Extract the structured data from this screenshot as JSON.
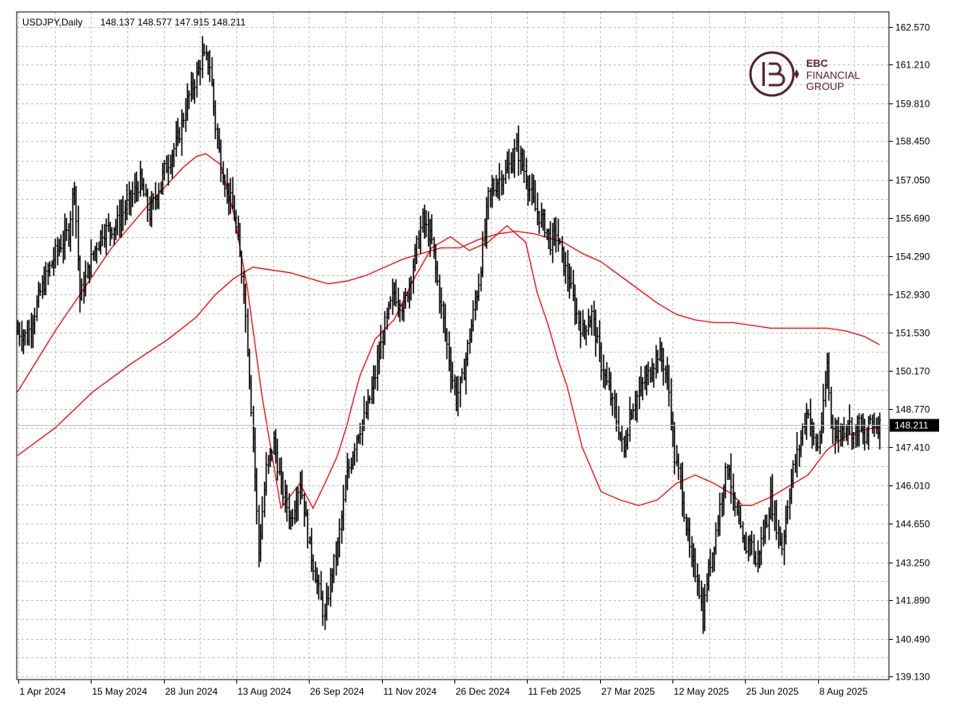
{
  "header": {
    "symbol": "USDJPY,Daily",
    "ohlc": "148.137 148.577 147.915 148.211"
  },
  "logo": {
    "line1": "EBC",
    "line2": "FINANCIAL",
    "line3": "GROUP",
    "color": "#5a2230"
  },
  "current_price_label": "148.211",
  "colors": {
    "background": "#ffffff",
    "grid": "#c0c0c0",
    "bars": "#000000",
    "moving_averages": "#ff0000",
    "price_tag_bg": "#000000",
    "price_tag_text": "#ffffff"
  },
  "chart_data": {
    "type": "ohlc",
    "title": "USDJPY,Daily",
    "y_axis_ticks": [
      "162.570",
      "161.210",
      "159.810",
      "158.450",
      "157.050",
      "155.690",
      "154.290",
      "152.930",
      "151.530",
      "150.170",
      "148.770",
      "147.410",
      "146.010",
      "144.650",
      "143.250",
      "141.890",
      "140.490",
      "139.130"
    ],
    "x_axis_ticks": [
      "1 Apr 2024",
      "15 May 2024",
      "28 Jun 2024",
      "13 Aug 2024",
      "26 Sep 2024",
      "11 Nov 2024",
      "26 Dec 2024",
      "11 Feb 2025",
      "27 Mar 2025",
      "12 May 2025",
      "25 Jun 2025",
      "8 Aug 2025"
    ],
    "ylim": [
      139.13,
      163.2
    ],
    "grid": true,
    "last_close": 148.211,
    "price_path": [
      [
        0,
        151.6
      ],
      [
        5,
        151.4
      ],
      [
        12,
        153.0
      ],
      [
        20,
        154.4
      ],
      [
        27,
        155.2
      ],
      [
        30,
        157.0
      ],
      [
        33,
        152.8
      ],
      [
        40,
        154.4
      ],
      [
        45,
        155.2
      ],
      [
        52,
        155.4
      ],
      [
        60,
        156.4
      ],
      [
        65,
        157.0
      ],
      [
        70,
        155.8
      ],
      [
        78,
        157.4
      ],
      [
        85,
        158.5
      ],
      [
        90,
        159.9
      ],
      [
        95,
        160.8
      ],
      [
        98,
        161.5
      ],
      [
        102,
        161.2
      ],
      [
        105,
        159.0
      ],
      [
        108,
        157.6
      ],
      [
        110,
        157.0
      ],
      [
        115,
        155.8
      ],
      [
        120,
        153.2
      ],
      [
        125,
        147.8
      ],
      [
        128,
        143.6
      ],
      [
        132,
        146.6
      ],
      [
        136,
        147.6
      ],
      [
        140,
        146.0
      ],
      [
        145,
        144.8
      ],
      [
        150,
        146.2
      ],
      [
        155,
        143.8
      ],
      [
        160,
        142.2
      ],
      [
        163,
        141.2
      ],
      [
        166,
        142.6
      ],
      [
        170,
        143.8
      ],
      [
        175,
        146.4
      ],
      [
        180,
        147.8
      ],
      [
        185,
        148.6
      ],
      [
        190,
        150.0
      ],
      [
        195,
        151.8
      ],
      [
        200,
        153.0
      ],
      [
        205,
        152.4
      ],
      [
        210,
        154.0
      ],
      [
        215,
        155.6
      ],
      [
        220,
        154.8
      ],
      [
        225,
        152.4
      ],
      [
        230,
        150.2
      ],
      [
        233,
        149.2
      ],
      [
        236,
        149.8
      ],
      [
        240,
        151.4
      ],
      [
        245,
        153.4
      ],
      [
        250,
        156.4
      ],
      [
        255,
        157.0
      ],
      [
        260,
        157.4
      ],
      [
        265,
        158.2
      ],
      [
        270,
        157.2
      ],
      [
        275,
        156.0
      ],
      [
        280,
        155.4
      ],
      [
        283,
        154.8
      ],
      [
        286,
        155.2
      ],
      [
        290,
        154.0
      ],
      [
        293,
        153.4
      ],
      [
        296,
        152.4
      ],
      [
        300,
        151.6
      ],
      [
        305,
        152.2
      ],
      [
        310,
        150.4
      ],
      [
        315,
        149.2
      ],
      [
        318,
        148.4
      ],
      [
        322,
        147.2
      ],
      [
        325,
        148.6
      ],
      [
        330,
        149.4
      ],
      [
        335,
        150.0
      ],
      [
        340,
        150.8
      ],
      [
        343,
        150.4
      ],
      [
        346,
        149.4
      ],
      [
        349,
        147.0
      ],
      [
        352,
        146.2
      ],
      [
        355,
        144.6
      ],
      [
        358,
        143.2
      ],
      [
        361,
        142.8
      ],
      [
        364,
        141.2
      ],
      [
        366,
        142.6
      ],
      [
        369,
        143.6
      ],
      [
        372,
        144.8
      ],
      [
        375,
        146.2
      ],
      [
        378,
        146.8
      ],
      [
        380,
        145.4
      ],
      [
        383,
        144.6
      ],
      [
        386,
        143.6
      ],
      [
        389,
        144.2
      ],
      [
        392,
        143.2
      ],
      [
        395,
        144.0
      ],
      [
        398,
        144.8
      ],
      [
        400,
        145.6
      ],
      [
        403,
        144.6
      ],
      [
        406,
        143.8
      ],
      [
        409,
        145.4
      ],
      [
        412,
        146.6
      ],
      [
        415,
        147.4
      ],
      [
        418,
        148.4
      ],
      [
        420,
        148.8
      ],
      [
        422,
        147.8
      ],
      [
        425,
        147.4
      ],
      [
        428,
        148.8
      ],
      [
        430,
        150.4
      ],
      [
        432,
        148.4
      ],
      [
        435,
        147.8
      ],
      [
        438,
        148.0
      ],
      [
        441,
        148.4
      ],
      [
        444,
        147.8
      ],
      [
        447,
        148.2
      ],
      [
        450,
        147.6
      ],
      [
        453,
        148.4
      ],
      [
        456,
        148.2
      ],
      [
        458,
        148.211
      ]
    ],
    "series": [
      {
        "name": "",
        "color": "#ff0000",
        "x": [
          0,
          20,
          50,
          70,
          88,
          95,
          100,
          108,
          115,
          122,
          130,
          140,
          150,
          157,
          164,
          170,
          175,
          178,
          182,
          190,
          200,
          210,
          220,
          230,
          240,
          250,
          260,
          270,
          276,
          282,
          287,
          292,
          300,
          310,
          320,
          330,
          340,
          350,
          360,
          370,
          380,
          385,
          390,
          400,
          410,
          420,
          430,
          440,
          448,
          455,
          458
        ],
        "y": [
          149.4,
          151.6,
          154.6,
          156.2,
          157.5,
          157.9,
          158.0,
          157.6,
          155.8,
          153.2,
          149.2,
          145.2,
          146.1,
          145.2,
          146.2,
          147.1,
          148.2,
          149.0,
          150.0,
          151.3,
          152.0,
          153.4,
          154.6,
          155.0,
          154.5,
          154.8,
          155.4,
          154.8,
          153.0,
          151.8,
          150.6,
          149.6,
          147.4,
          145.8,
          145.5,
          145.3,
          145.5,
          146.1,
          146.4,
          146.1,
          145.7,
          145.3,
          145.3,
          145.6,
          146.0,
          146.4,
          147.3,
          147.8,
          148.0,
          148.1,
          148.1
        ]
      },
      {
        "name": "",
        "color": "#ff0000",
        "x": [
          0,
          20,
          40,
          60,
          80,
          95,
          105,
          115,
          125,
          135,
          145,
          155,
          165,
          175,
          185,
          195,
          205,
          215,
          225,
          235,
          245,
          255,
          265,
          275,
          280,
          290,
          300,
          310,
          320,
          330,
          340,
          350,
          360,
          370,
          380,
          390,
          400,
          410,
          420,
          430,
          440,
          450,
          458
        ],
        "y": [
          147.1,
          148.1,
          149.4,
          150.4,
          151.3,
          152.1,
          152.9,
          153.5,
          153.9,
          153.8,
          153.7,
          153.5,
          153.3,
          153.4,
          153.6,
          153.9,
          154.2,
          154.4,
          154.6,
          154.6,
          154.9,
          155.1,
          155.2,
          155.1,
          155.0,
          154.8,
          154.4,
          154.1,
          153.6,
          153.1,
          152.6,
          152.2,
          152.0,
          151.9,
          151.9,
          151.8,
          151.7,
          151.7,
          151.7,
          151.7,
          151.6,
          151.4,
          151.1
        ]
      }
    ]
  }
}
